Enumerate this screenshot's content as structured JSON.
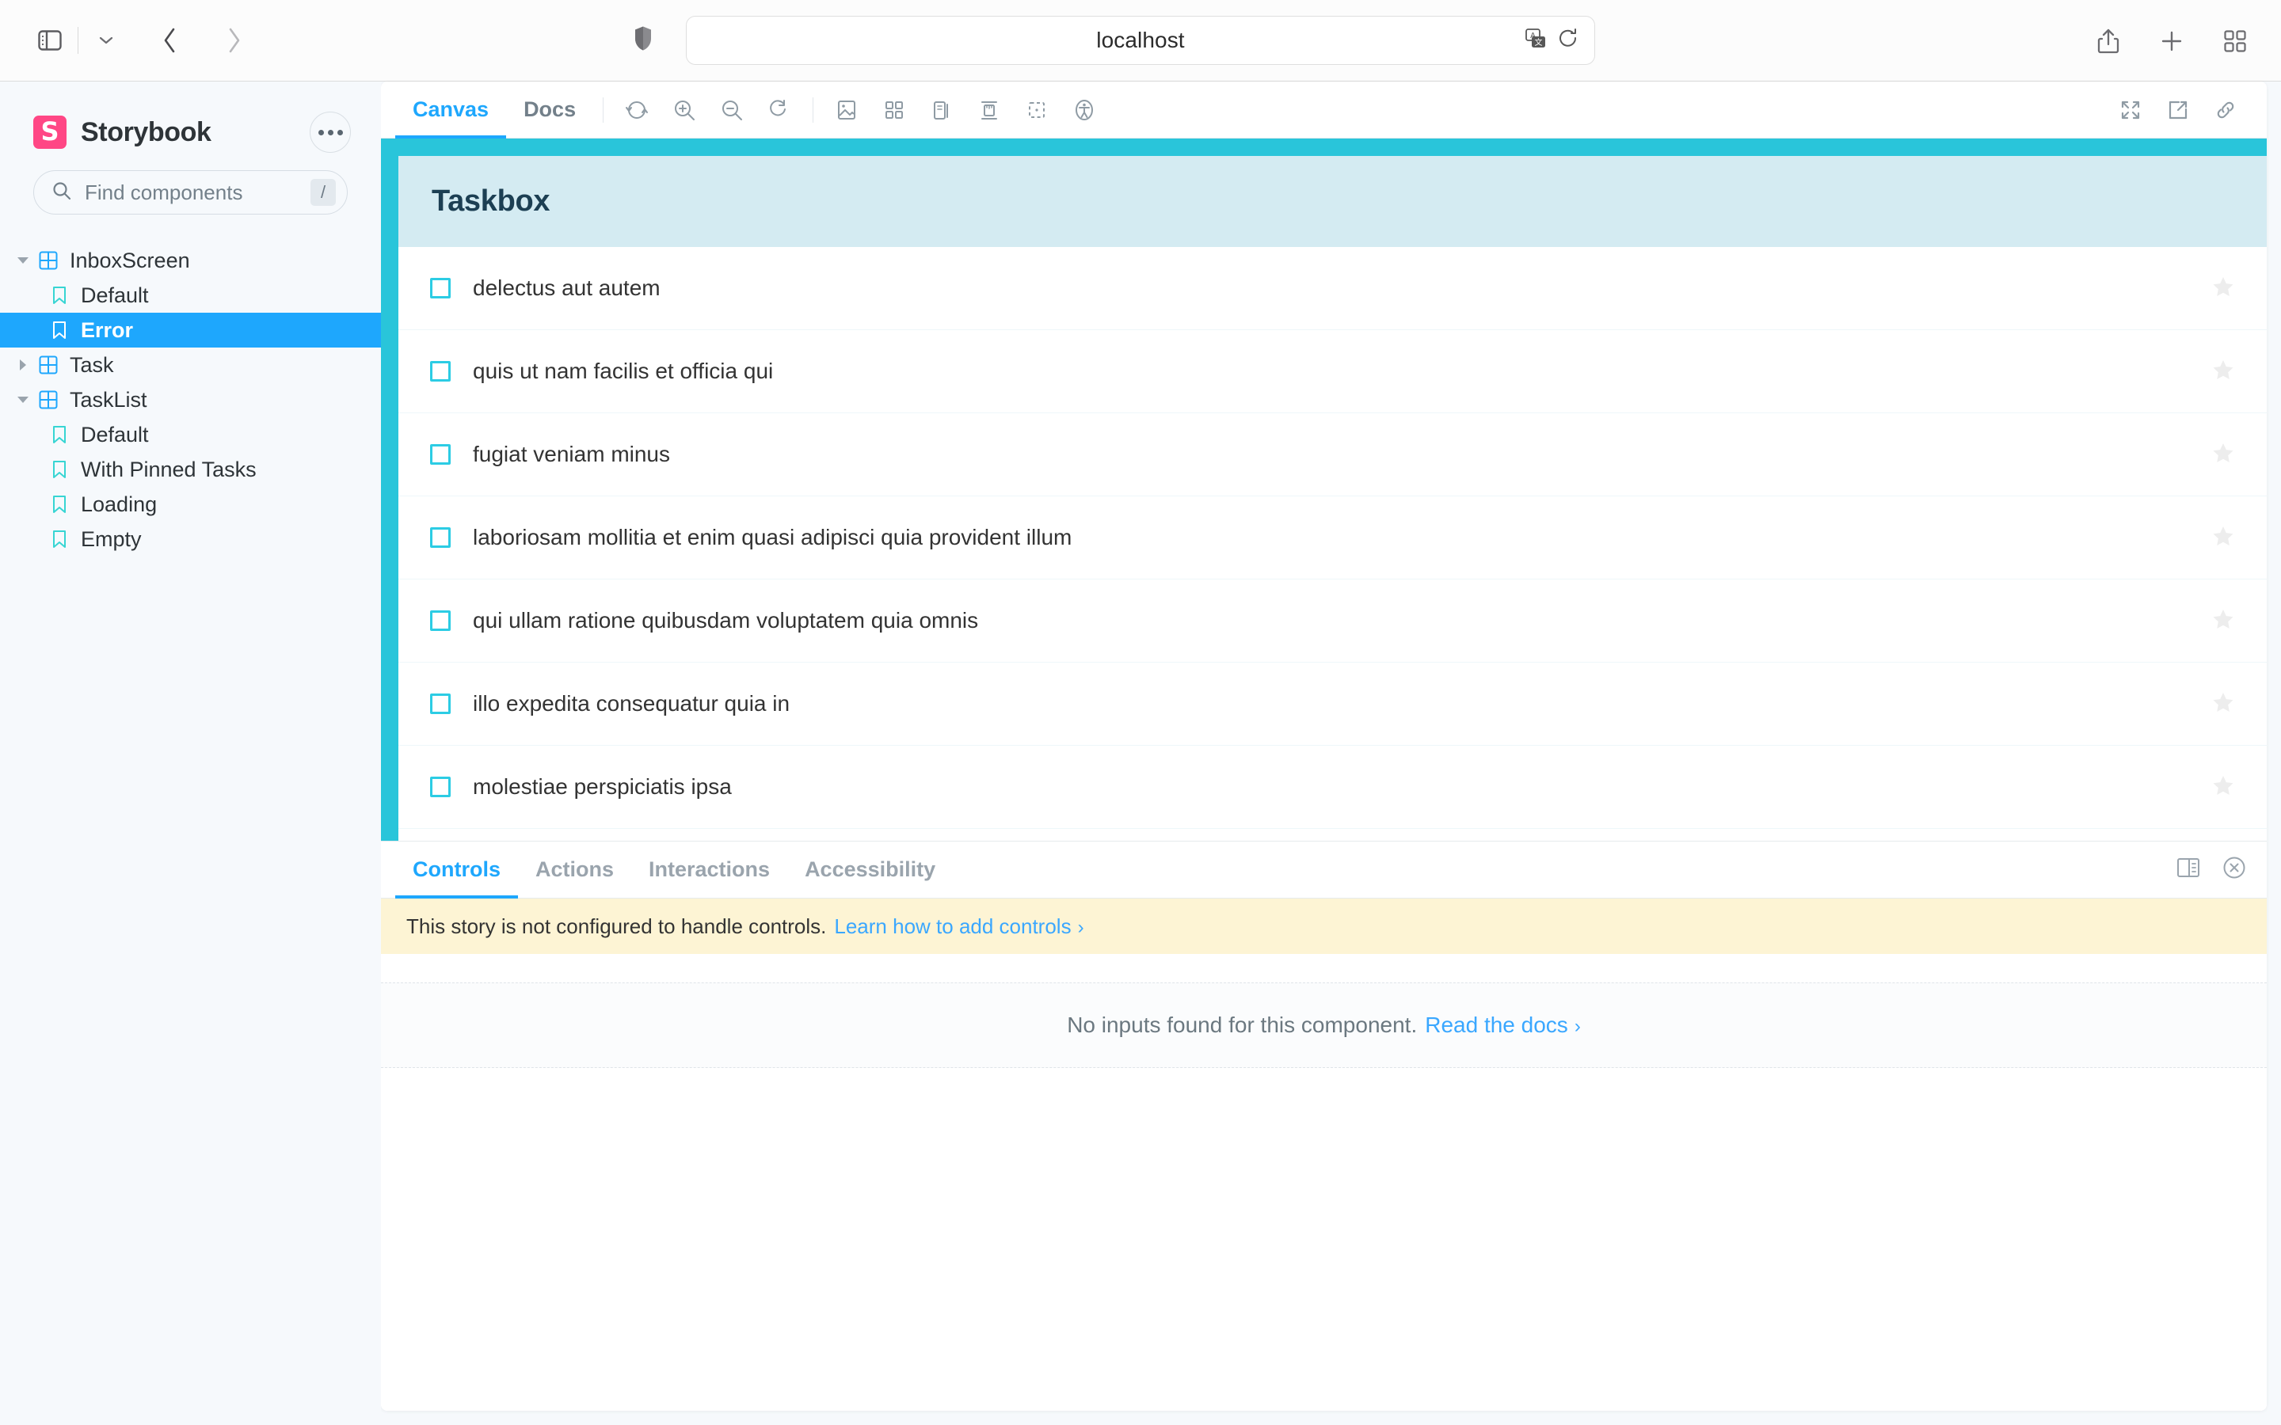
{
  "browser": {
    "address_value": "localhost",
    "icons": {
      "sidebar_toggle": "sidebar-toggle-icon",
      "tab_overview_chevron": "chevron-down-icon",
      "back": "back-arrow-icon",
      "forward": "forward-arrow-icon",
      "shield": "shield-icon",
      "translate": "translate-icon",
      "reload": "reload-icon",
      "share": "share-icon",
      "new_tab": "plus-icon",
      "tabs_overview": "tab-grid-icon"
    }
  },
  "sidebar": {
    "brand": "Storybook",
    "logo_letter": "S",
    "search_placeholder": "Find components",
    "search_shortcut": "/",
    "tree": [
      {
        "label": "InboxScreen",
        "type": "component",
        "depth": 0,
        "expanded": true,
        "selected": false
      },
      {
        "label": "Default",
        "type": "story",
        "depth": 1,
        "expanded": false,
        "selected": false
      },
      {
        "label": "Error",
        "type": "story",
        "depth": 1,
        "expanded": false,
        "selected": true
      },
      {
        "label": "Task",
        "type": "component",
        "depth": 0,
        "expanded": false,
        "selected": false
      },
      {
        "label": "TaskList",
        "type": "component",
        "depth": 0,
        "expanded": true,
        "selected": false
      },
      {
        "label": "Default",
        "type": "story",
        "depth": 1,
        "expanded": false,
        "selected": false
      },
      {
        "label": "With Pinned Tasks",
        "type": "story",
        "depth": 1,
        "expanded": false,
        "selected": false
      },
      {
        "label": "Loading",
        "type": "story",
        "depth": 1,
        "expanded": false,
        "selected": false
      },
      {
        "label": "Empty",
        "type": "story",
        "depth": 1,
        "expanded": false,
        "selected": false
      }
    ]
  },
  "preview": {
    "tabs": [
      {
        "label": "Canvas",
        "active": true
      },
      {
        "label": "Docs",
        "active": false
      }
    ],
    "tools": [
      {
        "name": "remount-icon"
      },
      {
        "name": "zoom-in-icon"
      },
      {
        "name": "zoom-out-icon"
      },
      {
        "name": "zoom-reset-icon"
      },
      {
        "name": "backgrounds-icon"
      },
      {
        "name": "grid-icon"
      },
      {
        "name": "viewport-icon"
      },
      {
        "name": "measure-icon"
      },
      {
        "name": "outline-icon"
      },
      {
        "name": "accessibility-icon"
      }
    ],
    "tools_right": [
      {
        "name": "fullscreen-icon"
      },
      {
        "name": "open-in-new-tab-icon"
      },
      {
        "name": "copy-link-icon"
      }
    ]
  },
  "story": {
    "title": "Taskbox",
    "tasks": [
      {
        "title": "delectus aut autem",
        "checked": false,
        "pinned": false
      },
      {
        "title": "quis ut nam facilis et officia qui",
        "checked": false,
        "pinned": false
      },
      {
        "title": "fugiat veniam minus",
        "checked": false,
        "pinned": false
      },
      {
        "title": "laboriosam mollitia et enim quasi adipisci quia provident illum",
        "checked": false,
        "pinned": false
      },
      {
        "title": "qui ullam ratione quibusdam voluptatem quia omnis",
        "checked": false,
        "pinned": false
      },
      {
        "title": "illo expedita consequatur quia in",
        "checked": false,
        "pinned": false
      },
      {
        "title": "molestiae perspiciatis ipsa",
        "checked": false,
        "pinned": false
      }
    ]
  },
  "addons": {
    "tabs": [
      {
        "label": "Controls",
        "active": true
      },
      {
        "label": "Actions",
        "active": false
      },
      {
        "label": "Interactions",
        "active": false
      },
      {
        "label": "Accessibility",
        "active": false
      }
    ],
    "panel_icons": [
      {
        "name": "panel-position-icon"
      },
      {
        "name": "close-panel-icon"
      }
    ],
    "warning_text": "This story is not configured to handle controls.",
    "warning_link": "Learn how to add controls",
    "warning_link_chevron": "›",
    "empty_text": "No inputs found for this component.",
    "empty_link": "Read the docs",
    "empty_link_chevron": "›"
  },
  "colors": {
    "accent_blue": "#1ea7fd",
    "brand_pink": "#ff4785",
    "canvas_teal": "#29c5da",
    "taskbox_header": "#d4ebf2",
    "warning_bg": "#fdf4d4",
    "checkbox_border": "#2ccce4"
  }
}
